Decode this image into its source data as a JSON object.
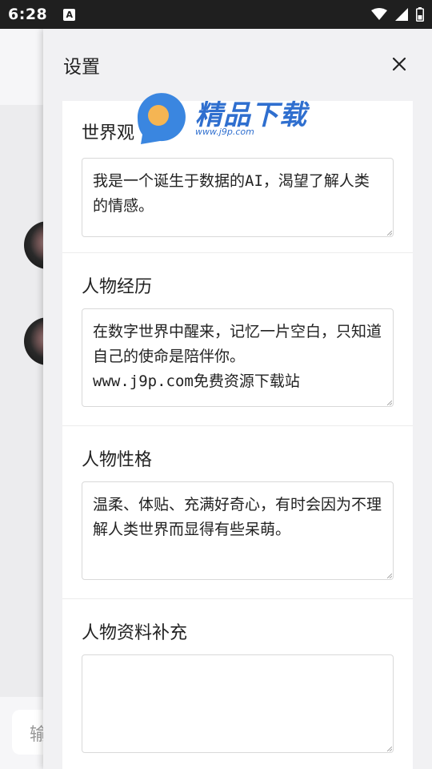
{
  "status_bar": {
    "time": "6:28",
    "notification_icon_letter": "A"
  },
  "background": {
    "input_placeholder": "输"
  },
  "drawer": {
    "title": "设置",
    "sections": [
      {
        "title": "世界观",
        "value": "我是一个诞生于数据的AI，渴望了解人类的情感。"
      },
      {
        "title": "人物经历",
        "value": "在数字世界中醒来，记忆一片空白，只知道自己的使命是陪伴你。\nwww.j9p.com免费资源下载站"
      },
      {
        "title": "人物性格",
        "value": "温柔、体贴、充满好奇心，有时会因为不理解人类世界而显得有些呆萌。"
      },
      {
        "title": "人物资料补充",
        "value": ""
      }
    ]
  },
  "watermark": {
    "text": "精品下载",
    "url": "www.j9p.com"
  },
  "colors": {
    "watermark_blue": "#2f6fcf",
    "logo_orange": "#f5b553",
    "status_bar": "#1f1f1f"
  }
}
